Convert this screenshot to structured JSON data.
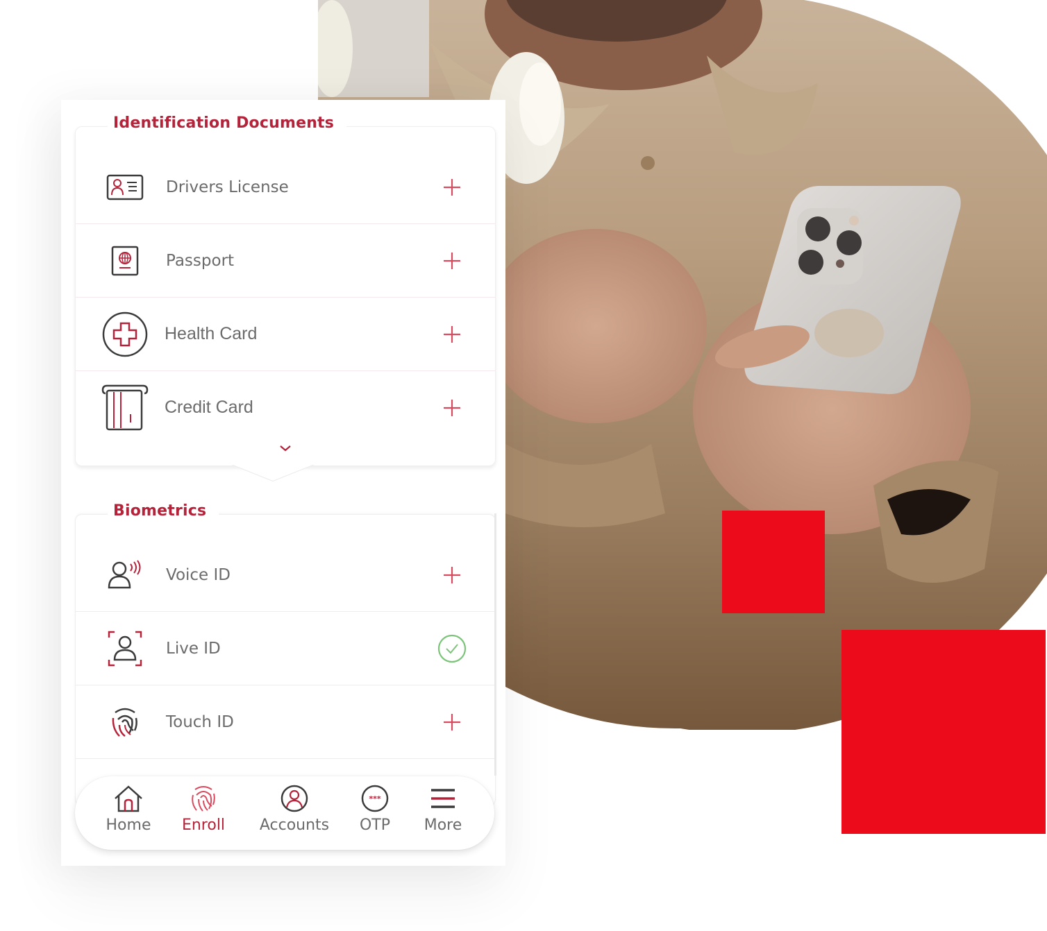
{
  "colors": {
    "brand_red": "#b5233a",
    "accent_red": "#ec0b1b",
    "success_green": "#7cc47a",
    "text_gray": "#6b6b6b",
    "icon_dark": "#3b3b3b"
  },
  "photo": {
    "description": "Person in beige shirt holding a white smartphone, white tulips in background"
  },
  "sections": [
    {
      "title": "Identification Documents",
      "items": [
        {
          "label": "Drivers License",
          "icon": "id-card-icon",
          "status": "add"
        },
        {
          "label": "Passport",
          "icon": "passport-icon",
          "status": "add"
        },
        {
          "label": "Health Card",
          "icon": "health-card-icon",
          "status": "add"
        },
        {
          "label": "Credit Card",
          "icon": "credit-card-icon",
          "status": "add"
        }
      ],
      "expand_icon": "chevron-down-icon"
    },
    {
      "title": "Biometrics",
      "items": [
        {
          "label": "Voice ID",
          "icon": "voice-id-icon",
          "status": "add"
        },
        {
          "label": "Live ID",
          "icon": "face-id-icon",
          "status": "done"
        },
        {
          "label": "Touch ID",
          "icon": "fingerprint-icon",
          "status": "add"
        }
      ]
    }
  ],
  "bottom_nav": {
    "active": "Enroll",
    "items": [
      {
        "label": "Home",
        "icon": "home-icon"
      },
      {
        "label": "Enroll",
        "icon": "fingerprint-icon"
      },
      {
        "label": "Accounts",
        "icon": "account-icon"
      },
      {
        "label": "OTP",
        "icon": "otp-icon"
      },
      {
        "label": "More",
        "icon": "menu-icon"
      }
    ]
  }
}
